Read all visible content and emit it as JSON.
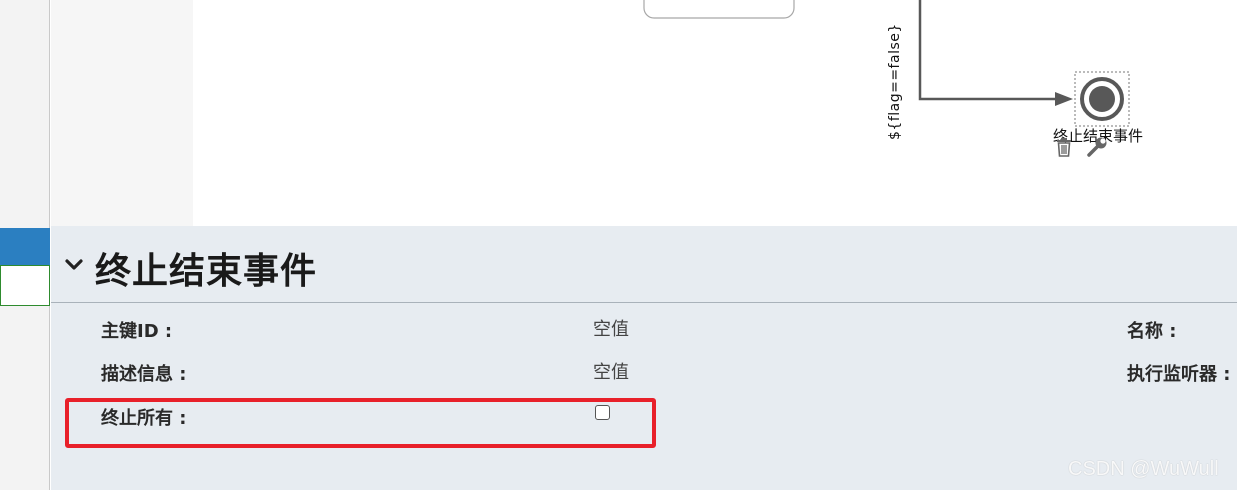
{
  "canvas": {
    "end_event_label": "终止结束事件",
    "sequence_condition": "${flag==false}"
  },
  "properties": {
    "title": "终止结束事件",
    "fields": {
      "id_label": "主键ID :",
      "id_value": "空值",
      "name_label": "名称 :",
      "documentation_label": "描述信息 :",
      "documentation_value": "空值",
      "listeners_label": "执行监听器 :",
      "terminate_all_label": "终止所有 :",
      "terminate_all_checked": false
    }
  },
  "watermark": "CSDN @WuWull",
  "colors": {
    "highlight": "#e8202a",
    "panel_bg": "#e7ecf1",
    "left_tab_blue": "#2b7fc1",
    "left_tab_green": "#2e8b2e"
  },
  "icons": [
    "chevron-down-icon",
    "trash-icon",
    "wrench-icon"
  ]
}
